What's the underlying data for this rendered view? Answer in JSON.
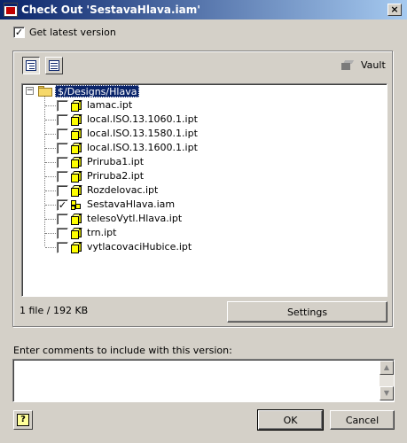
{
  "window": {
    "title": "Check Out 'SestavaHlava.iam'",
    "close_glyph": "×"
  },
  "options": {
    "get_latest_label": "Get latest version",
    "get_latest_checked": true
  },
  "toolbar": {
    "tree_view_icon": "tree-view-icon",
    "list_view_icon": "list-view-icon",
    "vault_label": "Vault"
  },
  "tree": {
    "root": {
      "label": "$/Designs/Hlava",
      "expander": "−",
      "expanded": true,
      "selected": true
    },
    "items": [
      {
        "name": "lamac.ipt",
        "checked": false,
        "icon": "part-icon"
      },
      {
        "name": "local.ISO.13.1060.1.ipt",
        "checked": false,
        "icon": "part-icon"
      },
      {
        "name": "local.ISO.13.1580.1.ipt",
        "checked": false,
        "icon": "part-icon"
      },
      {
        "name": "local.ISO.13.1600.1.ipt",
        "checked": false,
        "icon": "part-icon"
      },
      {
        "name": "Priruba1.ipt",
        "checked": false,
        "icon": "part-icon"
      },
      {
        "name": "Priruba2.ipt",
        "checked": false,
        "icon": "part-icon"
      },
      {
        "name": "Rozdelovac.ipt",
        "checked": false,
        "icon": "part-icon"
      },
      {
        "name": "SestavaHlava.iam",
        "checked": true,
        "icon": "assembly-icon"
      },
      {
        "name": "telesoVytl.Hlava.ipt",
        "checked": false,
        "icon": "part-icon"
      },
      {
        "name": "trn.ipt",
        "checked": false,
        "icon": "part-icon"
      },
      {
        "name": "vytlacovaciHubice.ipt",
        "checked": false,
        "icon": "part-icon"
      }
    ]
  },
  "status": {
    "summary": "1 file / 192 KB"
  },
  "buttons": {
    "settings": "Settings",
    "ok": "OK",
    "cancel": "Cancel",
    "help_glyph": "?"
  },
  "comments": {
    "label": "Enter comments to include with this version:",
    "value": ""
  },
  "colors": {
    "titlebar_start": "#0a246a",
    "titlebar_end": "#a6caf0",
    "selection": "#0a246a",
    "dialog_face": "#d4d0c8",
    "part_yellow": "#ffff00"
  }
}
